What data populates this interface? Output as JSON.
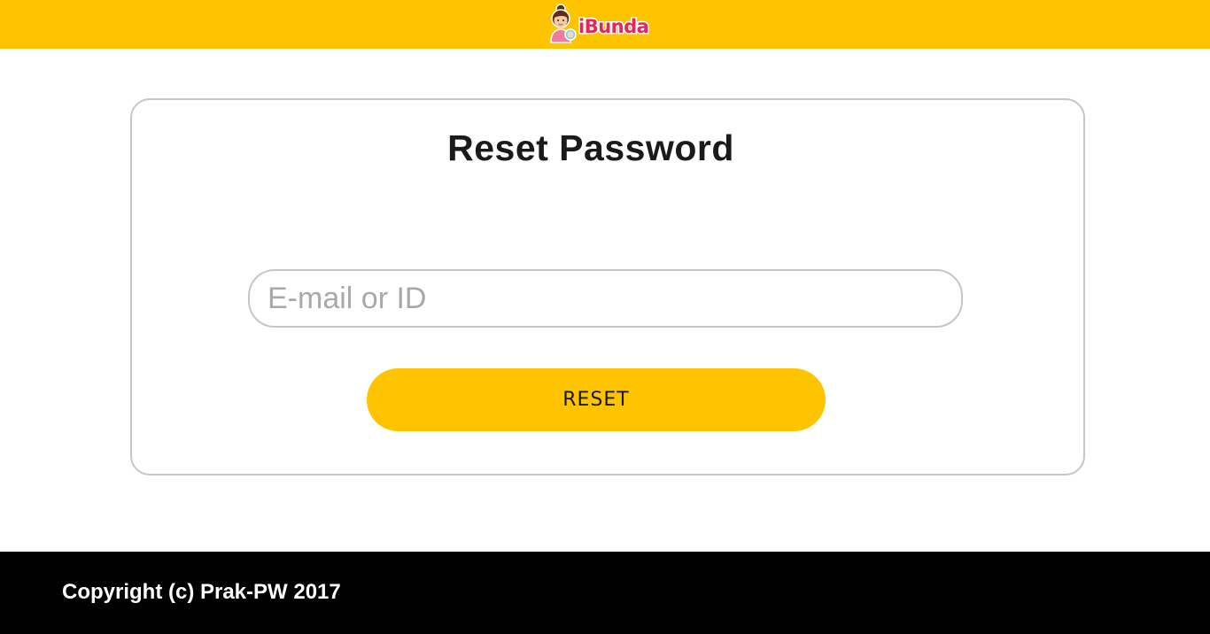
{
  "header": {
    "brand_name": "iBunda",
    "background_color": "#ffc400",
    "logo_icon": "mascot-icon"
  },
  "reset_form": {
    "title": "Reset Password",
    "email_placeholder": "E-mail or ID",
    "email_value": "",
    "reset_label": "RESET",
    "button_color": "#ffc400"
  },
  "footer": {
    "copyright": "Copyright (c) Prak-PW 2017",
    "background_color": "#000000"
  }
}
